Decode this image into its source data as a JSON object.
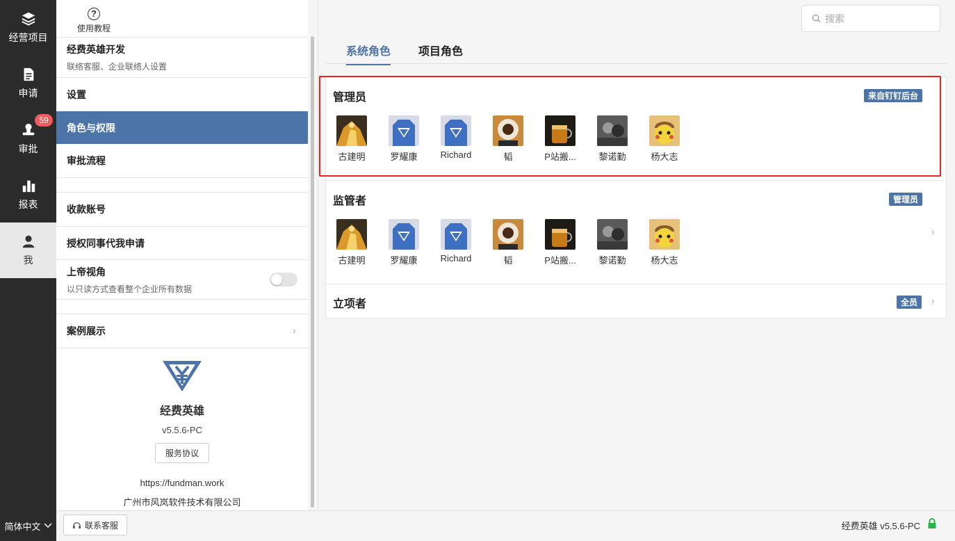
{
  "nav": {
    "items": [
      {
        "label": "经营项目",
        "icon": "layers-icon"
      },
      {
        "label": "申请",
        "icon": "document-icon"
      },
      {
        "label": "审批",
        "icon": "stamp-icon",
        "badge": "59"
      },
      {
        "label": "报表",
        "icon": "bar-chart-icon"
      },
      {
        "label": "我",
        "icon": "user-icon"
      }
    ]
  },
  "settings": {
    "tutorial_label": "使用教程",
    "org": {
      "title": "经费英雄开发",
      "subtitle": "联络客服、企业联络人设置"
    },
    "rows": {
      "settings": "设置",
      "roles": "角色与权限",
      "approval_flow": "审批流程",
      "payee_account": "收款账号",
      "authorize": "授权同事代我申请",
      "god_view": "上帝视角",
      "god_view_sub": "以只读方式查看整个企业所有数据",
      "cases": "案例展示"
    },
    "god_view_enabled": false
  },
  "brand": {
    "name": "经费英雄",
    "version": "v5.5.6-PC",
    "agreement": "服务协议",
    "url": "https://fundman.work",
    "company": "广州市风岚软件技术有限公司"
  },
  "search": {
    "placeholder": "搜索"
  },
  "tabs": [
    {
      "label": "系统角色",
      "active": true
    },
    {
      "label": "项目角色",
      "active": false
    }
  ],
  "roles": [
    {
      "title": "管理员",
      "tag": "来自钉钉后台",
      "members": [
        "古建明",
        "罗耀康",
        "Richard",
        "韬",
        "P站搬...",
        "黎诺勤",
        "杨大志"
      ]
    },
    {
      "title": "监管者",
      "tag": "管理员",
      "members": [
        "古建明",
        "罗耀康",
        "Richard",
        "韬",
        "P站搬...",
        "黎诺勤",
        "杨大志"
      ]
    },
    {
      "title": "立项者",
      "tag": "全员",
      "members": []
    }
  ],
  "footer": {
    "language": "简体中文",
    "support": "联系客服",
    "version": "经费英雄 v5.5.6-PC"
  },
  "colors": {
    "accent": "#4d74a8",
    "nav_bg": "#2b2b2b",
    "highlight": "#e22222",
    "badge": "#f05a5a",
    "lock": "#2bb34a"
  }
}
